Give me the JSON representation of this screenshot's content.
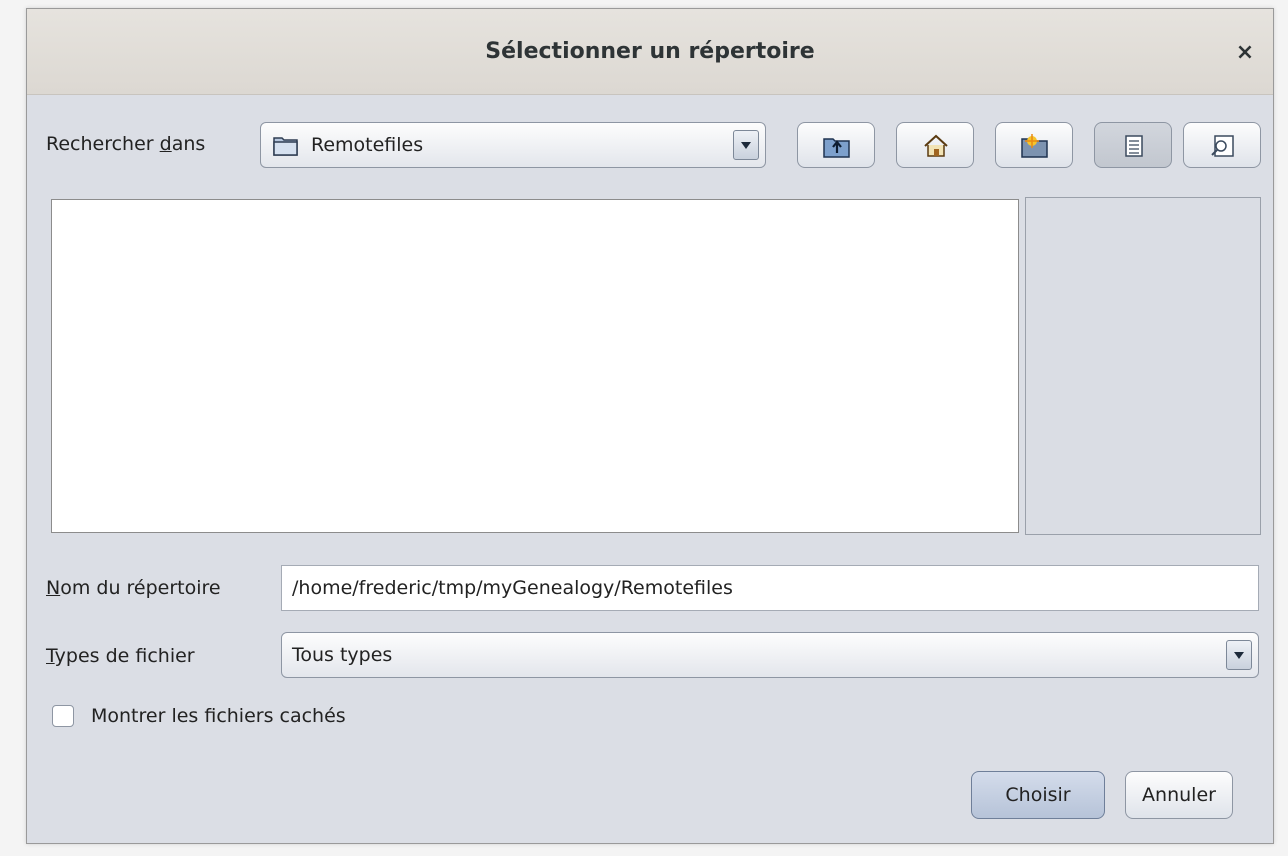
{
  "dialog": {
    "title": "Sélectionner un répertoire",
    "close_symbol": "×"
  },
  "lookin": {
    "label_prefix": "Rechercher ",
    "label_mnemonic": "d",
    "label_suffix": "ans",
    "current_folder": "Remotefiles",
    "folder_icon": "folder-icon"
  },
  "toolbar": {
    "buttons": [
      {
        "name": "up-one-level",
        "icon": "folder-up-icon"
      },
      {
        "name": "home",
        "icon": "home-icon"
      },
      {
        "name": "new-folder",
        "icon": "new-folder-icon"
      },
      {
        "name": "list-view",
        "icon": "list-view-icon",
        "active": true
      },
      {
        "name": "details-view",
        "icon": "details-view-icon"
      }
    ]
  },
  "form": {
    "name_label_mnemonic": "N",
    "name_label_rest": "om du répertoire",
    "name_value": "/home/frederic/tmp/myGenealogy/Remotefiles",
    "types_label_mnemonic": "T",
    "types_label_rest": "ypes de fichier",
    "types_value": "Tous types",
    "show_hidden_label": "Montrer les fichiers cachés",
    "show_hidden_checked": false
  },
  "actions": {
    "choose_label": "Choisir",
    "cancel_label": "Annuler"
  }
}
